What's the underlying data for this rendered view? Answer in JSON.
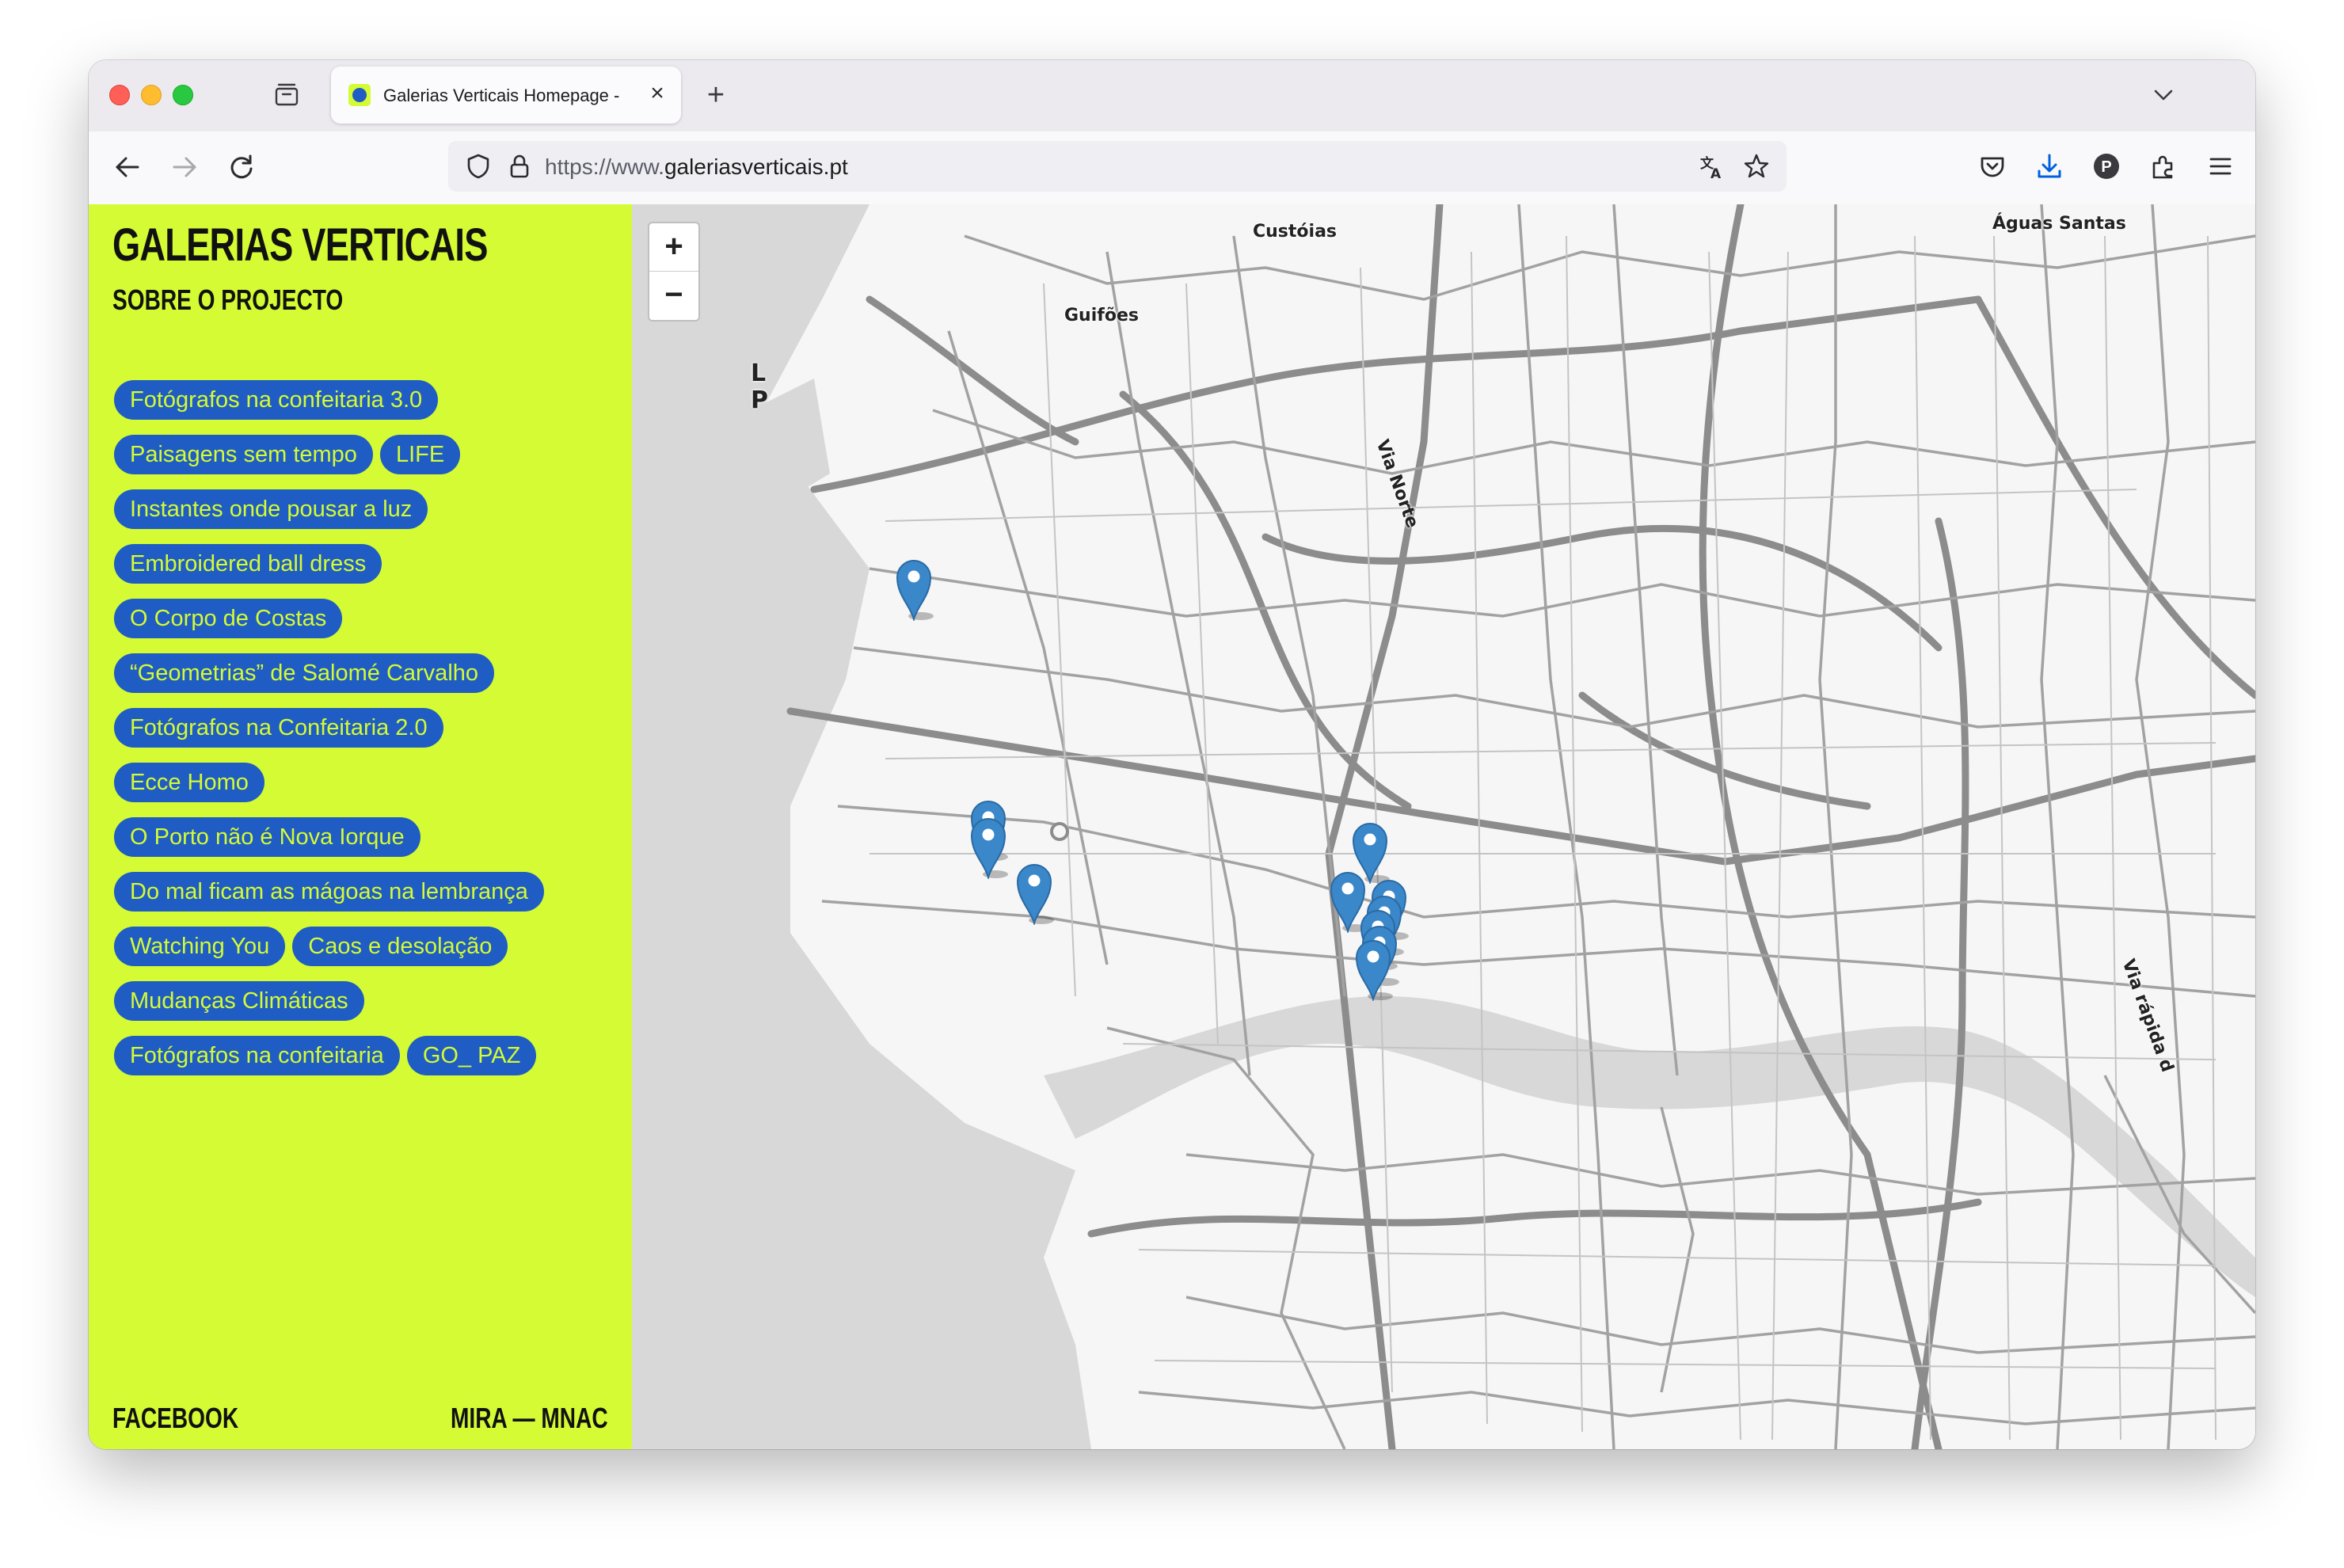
{
  "browser": {
    "tab_title": "Galerias Verticais Homepage -",
    "url_scheme": "https://www.",
    "url_host": "galeriasverticais.pt",
    "profile_initial": "P",
    "accent_color": "#0060df"
  },
  "sidebar": {
    "title": "GALERIAS VERTICAIS",
    "about": "SOBRE O PROJECTO",
    "background_color": "#d4fb33",
    "pill_color": "#1f5cc4",
    "exhibitions": [
      "Fotógrafos na confeitaria 3.0",
      "Paisagens sem tempo",
      "LIFE",
      "Instantes onde pousar a luz",
      "Embroidered ball dress",
      "O Corpo de Costas",
      "“Geometrias” de Salomé Carvalho",
      "Fotógrafos na Confeitaria 2.0",
      "Ecce Homo",
      "O Porto não é Nova Iorque",
      "Do mal ficam as mágoas na lembrança",
      "Watching You",
      "Caos e desolação",
      "Mudanças Climáticas",
      "Fotógrafos na confeitaria",
      "GO_ PAZ"
    ],
    "footer_left": "FACEBOOK",
    "footer_right": "MIRA — MNAC"
  },
  "map": {
    "zoom_in": "+",
    "zoom_out": "−",
    "marker_color": "#3a87c9",
    "places": {
      "custoias": "Custóias",
      "aguas_santas": "Águas Santas",
      "guifoes": "Guifões",
      "via_norte": "Via Norte",
      "via_rapida": "Via rápida d",
      "partial_1": "L",
      "partial_2": "P"
    },
    "marker_count": 12
  }
}
